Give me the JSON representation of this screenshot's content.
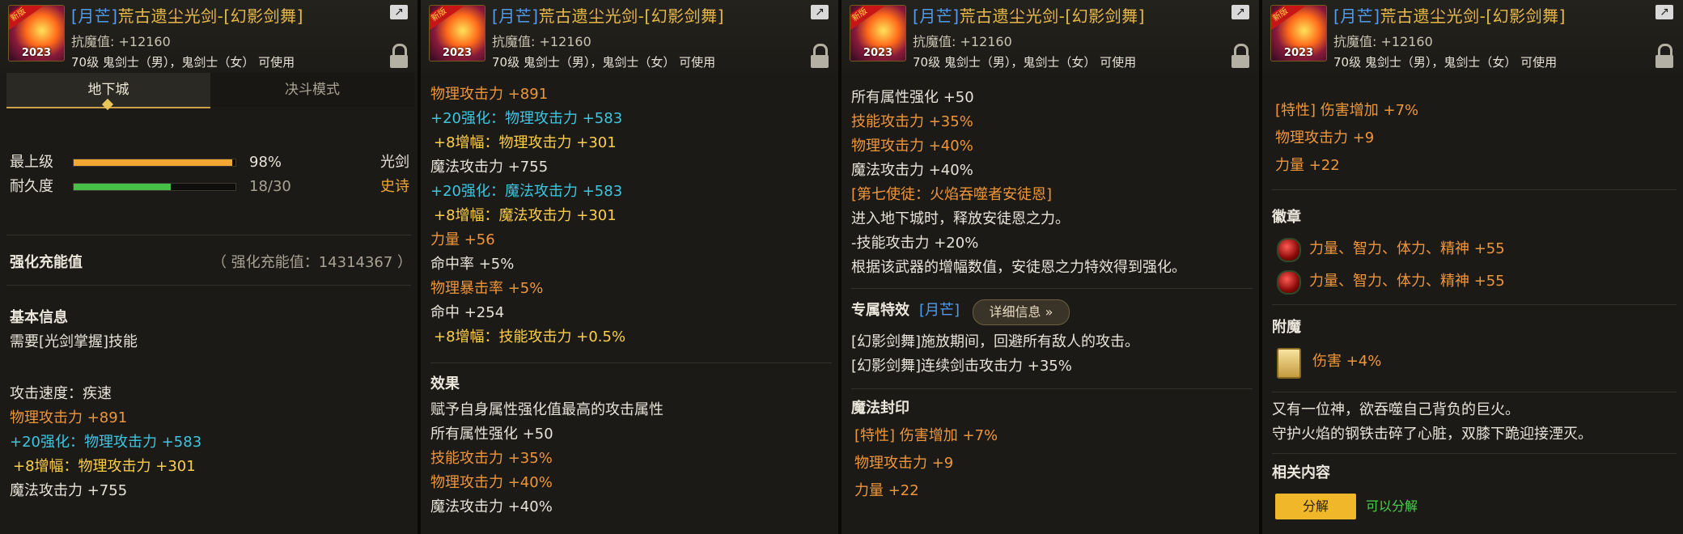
{
  "item": {
    "rarity_tag": "[月芒]",
    "name": "荒古遗尘光剑-[幻影剑舞]",
    "resist": "抗魔值: +12160",
    "requirement": "70级 鬼剑士（男），鬼剑士（女） 可使用",
    "icon_level": "2023",
    "icon_banner": "新版"
  },
  "panel1": {
    "tab_dungeon": "地下城",
    "tab_duel": "决斗模式",
    "grade_label": "最上级",
    "grade_value": "98%",
    "grade_fraction": 0.98,
    "durability_label": "耐久度",
    "durability_value": "18/30",
    "durability_fraction": 0.6,
    "type": "光剑",
    "quality": "史诗",
    "reinforce_label": "强化充能值",
    "reinforce_value": "（ 强化充能值：14314367 ）",
    "basic_header": "基本信息",
    "skill_req": "需要[光剑掌握]技能",
    "atk_speed": "攻击速度：疾速",
    "phys_atk": "物理攻击力 +891",
    "reinf_prefix": "+20",
    "reinf_phys": "强化：物理攻击力 +583",
    "amp_prefix": "+8",
    "amp_phys": "增幅：物理攻击力 +301",
    "mag_atk": "魔法攻击力 +755"
  },
  "panel2": {
    "phys_atk": "物理攻击力 +891",
    "reinf_prefix": "+20",
    "reinf_phys": "强化：物理攻击力 +583",
    "amp_prefix": "+8",
    "amp_phys": "增幅：物理攻击力 +301",
    "mag_atk": "魔法攻击力 +755",
    "reinf_mag": "强化：魔法攻击力 +583",
    "amp_mag": "增幅：魔法攻击力 +301",
    "strength": "力量 +56",
    "hit_rate": "命中率 +5%",
    "phys_crit": "物理暴击率 +5%",
    "hit": "命中 +254",
    "amp_skill": "增幅：技能攻击力 +0.5%",
    "effect_header": "效果",
    "effect_desc": "赋予自身属性强化值最高的攻击属性",
    "all_elem": "所有属性强化 +50",
    "skill_atk": "技能攻击力 +35%",
    "phys_pct": "物理攻击力 +40%",
    "mag_pct_partial": "魔法攻击力 +40%"
  },
  "panel3": {
    "all_elem": "所有属性强化 +50",
    "skill_atk": "技能攻击力 +35%",
    "phys_pct": "物理攻击力 +40%",
    "mag_pct": "魔法攻击力 +40%",
    "apostle_title": "[第七使徒：火焰吞噬者安徒恩]",
    "apostle_1": "进入地下城时，释放安徒恩之力。",
    "apostle_2": "-技能攻击力 +20%",
    "apostle_3": "根据该武器的增幅数值，安徒恩之力特效得到强化。",
    "exclusive_label": "专属特效",
    "exclusive_tag": "[月芒]",
    "detail_button": "详细信息",
    "exclusive_1": "[幻影剑舞]施放期间，回避所有敌人的攻击。",
    "exclusive_2": "[幻影剑舞]连续剑击攻击力 +35%",
    "seal_header": "魔法封印",
    "seal_1": "[特性] 伤害增加 +7%",
    "seal_2": "物理攻击力 +9",
    "seal_3": "力量 +22"
  },
  "panel4": {
    "seal_1": "[特性] 伤害增加 +7%",
    "seal_2": "物理攻击力 +9",
    "seal_3": "力量 +22",
    "emblem_header": "徽章",
    "emblem_1": "力量、智力、体力、精神 +55",
    "emblem_2": "力量、智力、体力、精神 +55",
    "enchant_header": "附魔",
    "enchant_1": "伤害 +4%",
    "flavor_1": "又有一位神，欲吞噬自己背负的巨火。",
    "flavor_2": "守护火焰的钢铁击碎了心脏，双膝下跪迎接湮灭。",
    "related_header": "相关内容",
    "disassemble_button": "分解",
    "disassemble_status": "可以分解"
  },
  "colors": {
    "accent_gold": "#e8b84a",
    "blue_tag": "#4f9cf0",
    "orange_stat": "#f0963a",
    "cyan_reinforce": "#3cc6df",
    "yellow_amp": "#ffcf46",
    "bar_orange": "#f2a733",
    "bar_green": "#46c046"
  }
}
